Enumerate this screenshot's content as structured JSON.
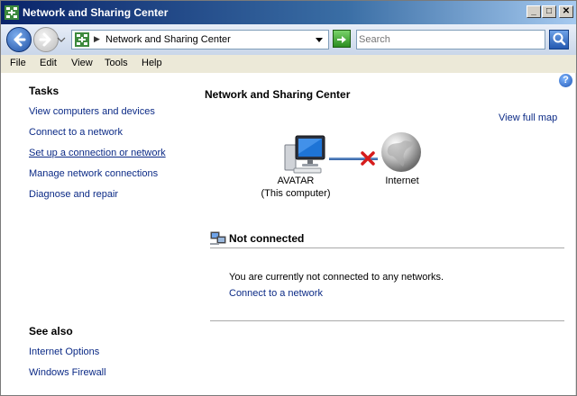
{
  "window": {
    "title": "Network and Sharing Center"
  },
  "title_buttons": {
    "minimize": "_",
    "maximize": "□",
    "close": "✕"
  },
  "address": {
    "text": "Network and Sharing Center",
    "separator": "▶"
  },
  "search": {
    "placeholder": "Search"
  },
  "menu": [
    "File",
    "Edit",
    "View",
    "Tools",
    "Help"
  ],
  "help": {
    "glyph": "?"
  },
  "tasks": {
    "heading": "Tasks",
    "items": [
      "View computers and devices",
      "Connect to a network",
      "Set up a connection or network",
      "Manage network connections",
      "Diagnose and repair"
    ]
  },
  "see_also": {
    "heading": "See also",
    "items": [
      "Internet Options",
      "Windows Firewall"
    ]
  },
  "main": {
    "title": "Network and Sharing Center",
    "view_full_map": "View full map",
    "computer_name": "AVATAR",
    "computer_sub": "(This computer)",
    "internet_label": "Internet",
    "status_label": "Not connected",
    "status_message": "You are currently not connected to any networks.",
    "connect_link": "Connect to a network"
  },
  "colors": {
    "link": "#0b2a86",
    "titlebar": "#0a246a",
    "error": "#d61c1c"
  },
  "icons": [
    "network-center-icon",
    "back-arrow-icon",
    "forward-arrow-icon",
    "refresh-go-icon",
    "search-icon",
    "help-icon",
    "computer-icon",
    "globe-icon",
    "disconnected-x-icon",
    "network-status-icon"
  ]
}
